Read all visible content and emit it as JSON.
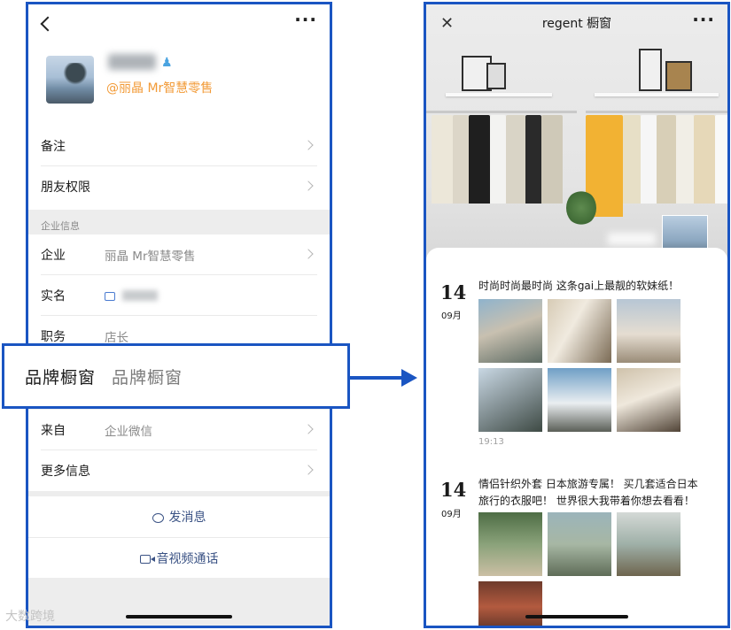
{
  "left_phone": {
    "profile": {
      "company_tag": "@丽晶 Mr智慧零售"
    },
    "rows": {
      "remark": "备注",
      "friend_permission": "朋友权限",
      "section_enterprise": "企业信息",
      "company_label": "企业",
      "company_value": "丽晶 Mr智慧零售",
      "realname_label": "实名",
      "position_label": "职务",
      "position_value": "店长",
      "source_label": "来自",
      "source_value": "企业微信",
      "more_info": "更多信息"
    },
    "actions": {
      "send_message": "发消息",
      "av_call": "音视频通话"
    }
  },
  "banner": {
    "label": "品牌橱窗",
    "value": "品牌橱窗"
  },
  "right_phone": {
    "title": "regent 橱窗",
    "posts": [
      {
        "day": "14",
        "month": "09月",
        "text": "时尚时尚最时尚 这条gai上最靓的软妹纸！",
        "time": "19:13"
      },
      {
        "day": "14",
        "month": "09月",
        "text": "情侣针织外套 日本旅游专属！ 买几套适合日本旅行的衣服吧！ 世界很大我带着你想去看看！"
      }
    ]
  },
  "watermark": "大数跨境",
  "colors": {
    "frame_blue": "#1a55c2",
    "accent_orange": "#f29b38",
    "link_blue": "#3a5284"
  }
}
